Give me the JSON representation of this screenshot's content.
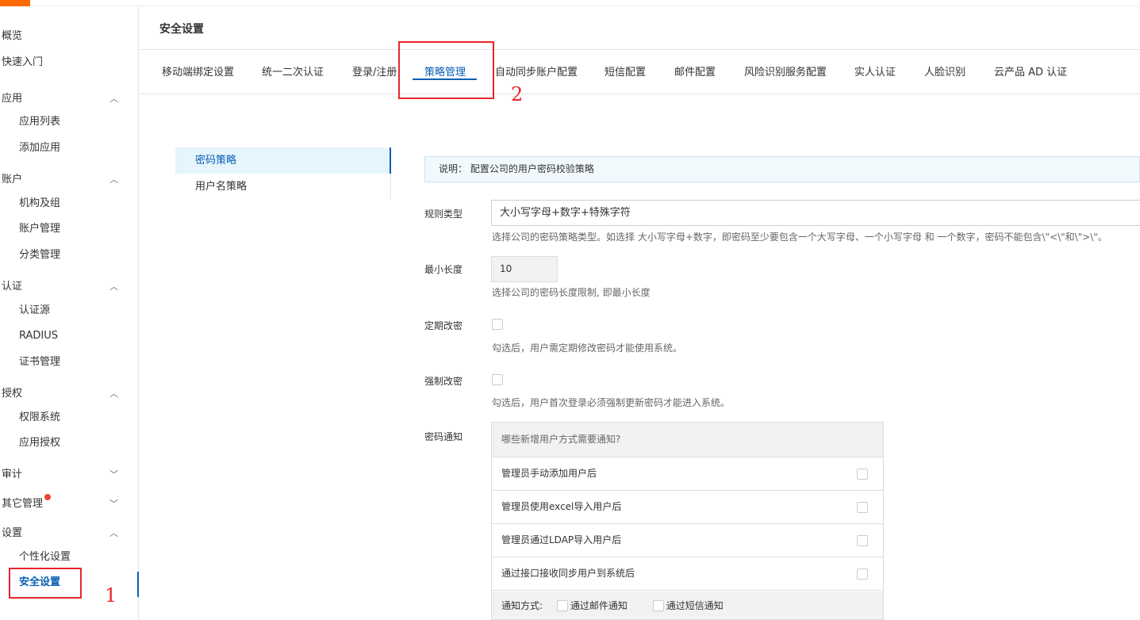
{
  "header": {
    "title": "安全设置"
  },
  "sidebar": {
    "items": [
      {
        "label": "概览",
        "level": "top"
      },
      {
        "label": "快速入门",
        "level": "top"
      },
      {
        "label": "应用",
        "level": "top",
        "chevron": "up"
      },
      {
        "label": "应用列表",
        "level": "sub"
      },
      {
        "label": "添加应用",
        "level": "sub"
      },
      {
        "label": "账户",
        "level": "top",
        "chevron": "up"
      },
      {
        "label": "机构及组",
        "level": "sub"
      },
      {
        "label": "账户管理",
        "level": "sub"
      },
      {
        "label": "分类管理",
        "level": "sub"
      },
      {
        "label": "认证",
        "level": "top",
        "chevron": "up"
      },
      {
        "label": "认证源",
        "level": "sub"
      },
      {
        "label": "RADIUS",
        "level": "sub"
      },
      {
        "label": "证书管理",
        "level": "sub"
      },
      {
        "label": "授权",
        "level": "top",
        "chevron": "up"
      },
      {
        "label": "权限系统",
        "level": "sub"
      },
      {
        "label": "应用授权",
        "level": "sub"
      },
      {
        "label": "审计",
        "level": "top",
        "chevron": "down"
      },
      {
        "label": "其它管理",
        "level": "top",
        "chevron": "down",
        "badge": true
      },
      {
        "label": "设置",
        "level": "top",
        "chevron": "up"
      },
      {
        "label": "个性化设置",
        "level": "sub"
      },
      {
        "label": "安全设置",
        "level": "sub",
        "active": true
      }
    ]
  },
  "tabs": [
    {
      "label": "移动端绑定设置"
    },
    {
      "label": "统一二次认证"
    },
    {
      "label": "登录/注册"
    },
    {
      "label": "策略管理",
      "active": true
    },
    {
      "label": "自动同步账户配置"
    },
    {
      "label": "短信配置"
    },
    {
      "label": "邮件配置"
    },
    {
      "label": "风险识别服务配置"
    },
    {
      "label": "实人认证"
    },
    {
      "label": "人脸识别"
    },
    {
      "label": "云产品 AD 认证"
    }
  ],
  "policy_menu": [
    {
      "label": "密码策略",
      "active": true
    },
    {
      "label": "用户名策略"
    }
  ],
  "note": "说明：  配置公司的用户密码校验策略",
  "form": {
    "rule_type": {
      "label": "规则类型",
      "value": "大小写字母+数字+特殊字符",
      "help": "选择公司的密码策略类型。如选择 大小写字母+数字，即密码至少要包含一个大写字母、一个小写字母 和 一个数字，密码不能包含\\\"<\\\"和\\\">\\\"。"
    },
    "min_length": {
      "label": "最小长度",
      "value": "10",
      "help": "选择公司的密码长度限制, 即最小长度"
    },
    "periodic_change": {
      "label": "定期改密",
      "checked": false,
      "help": "勾选后，用户需定期修改密码才能使用系统。"
    },
    "force_change": {
      "label": "强制改密",
      "checked": false,
      "help": "勾选后，用户首次登录必须强制更新密码才能进入系统。"
    },
    "password_notify": {
      "label": "密码通知",
      "question": "哪些新增用户方式需要通知?",
      "rows": [
        {
          "label": "管理员手动添加用户后",
          "checked": false
        },
        {
          "label": "管理员使用excel导入用户后",
          "checked": false
        },
        {
          "label": "管理员通过LDAP导入用户后",
          "checked": false
        },
        {
          "label": "通过接口接收同步用户到系统后",
          "checked": false
        }
      ],
      "method_label": "通知方式:",
      "methods": [
        {
          "label": "通过邮件通知",
          "checked": false
        },
        {
          "label": "通过短信通知",
          "checked": false
        }
      ]
    }
  },
  "annotations": [
    "1",
    "2"
  ],
  "colors": {
    "accent": "#0a5fb4",
    "brand": "#ff6a00",
    "annotation": "#e8262b",
    "badge": "#f04134"
  }
}
